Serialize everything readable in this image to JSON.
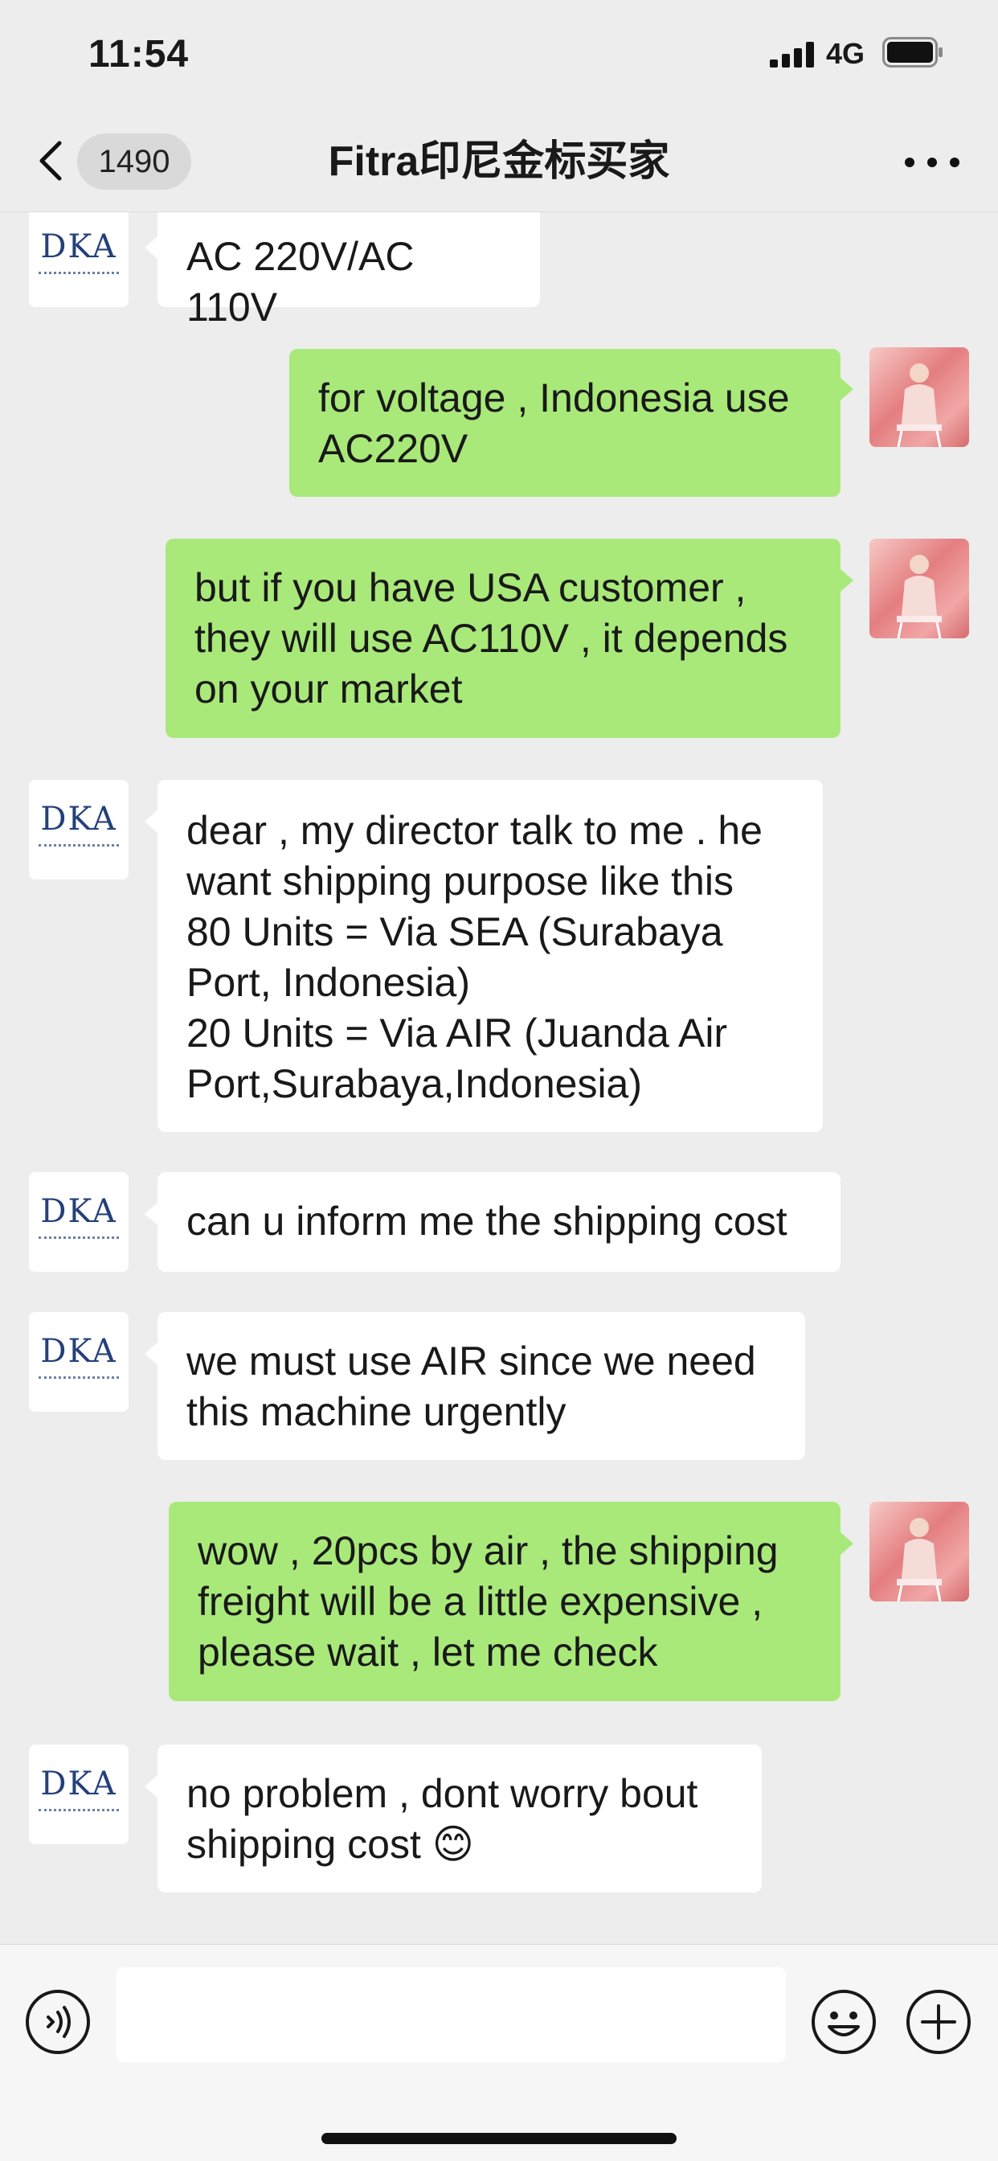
{
  "status": {
    "time": "11:54",
    "network": "4G"
  },
  "nav": {
    "unread_count": "1490",
    "title": "Fitra印尼金标买家"
  },
  "messages": [
    {
      "side": "in",
      "sender": "DKA",
      "text": "AC 220V/AC 110V"
    },
    {
      "side": "out",
      "sender": "me",
      "text": "for voltage , Indonesia use\nAC220V"
    },
    {
      "side": "out",
      "sender": "me",
      "text": "but if you have USA customer ,\nthey will use AC110V , it depends\non your market"
    },
    {
      "side": "in",
      "sender": "DKA",
      "text": "dear , my director talk to me . he\nwant shipping purpose like this\n80 Units = Via SEA (Surabaya\nPort, Indonesia)\n20 Units = Via AIR (Juanda Air\nPort,Surabaya,Indonesia)"
    },
    {
      "side": "in",
      "sender": "DKA",
      "text": "can u inform me the shipping cost"
    },
    {
      "side": "in",
      "sender": "DKA",
      "text": "we must use AIR since we need\nthis machine urgently"
    },
    {
      "side": "out",
      "sender": "me",
      "text": "wow , 20pcs by air , the shipping\nfreight will be a little expensive ,\nplease wait , let me check"
    },
    {
      "side": "in",
      "sender": "DKA",
      "text": "no problem , dont worry bout\nshipping cost 😊"
    }
  ],
  "avatars": {
    "contact_logo": "DKA"
  },
  "input": {
    "value": ""
  },
  "colors": {
    "outgoing_bubble": "#a9e97a",
    "incoming_bubble": "#ffffff",
    "background": "#ededed"
  }
}
